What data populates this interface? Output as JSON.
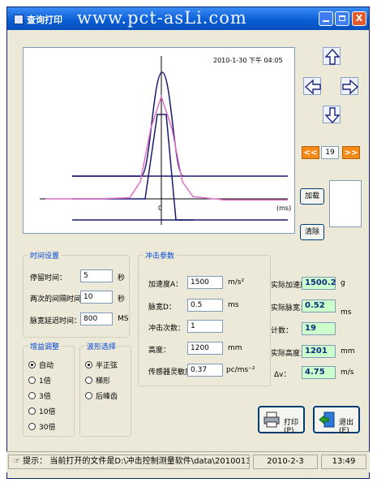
{
  "window": {
    "title": "查询打印",
    "watermark": "www.pct-asLi.com",
    "close_label": "X"
  },
  "chart": {
    "timestamp": "2010-1-30 下午 04:05",
    "x_zero_label": "0",
    "x_unit": "(ms)",
    "colors": {
      "envelope": "#1a1a6e",
      "signal": "#e06ec8",
      "axis": "#000000"
    }
  },
  "chart_data": {
    "type": "line",
    "title": "",
    "xlabel": "ms",
    "ylabel": "",
    "x": [
      -11,
      -6,
      -3,
      -2,
      -1,
      0,
      1,
      2,
      3,
      6,
      12
    ],
    "series": [
      {
        "values": [
          0,
          0,
          0.01,
          0.15,
          0.62,
          0.9,
          0.62,
          0.15,
          0.02,
          -0.01,
          -0.01
        ]
      }
    ]
  },
  "navigation": {
    "up_icon": "arrow-up-icon",
    "down_icon": "arrow-down-icon",
    "left_icon": "arrow-left-icon",
    "right_icon": "arrow-right-icon",
    "prev_label": "<<",
    "next_label": ">>",
    "page": "19"
  },
  "side_buttons": {
    "load": "加载",
    "clear": "清除"
  },
  "time_settings": {
    "title": "时间设置",
    "stop_time_label": "停留时间：",
    "stop_time_value": "5",
    "stop_time_unit": "秒",
    "interval_label": "两次的间隔时间：",
    "interval_value": "10",
    "interval_unit": "秒",
    "pulse_width_label": "脉宽延迟时间：",
    "pulse_width_value": "800",
    "pulse_width_unit": "MS"
  },
  "impact_params": {
    "title": "冲击参数",
    "accel_label": "加速度A：",
    "accel_value": "1500",
    "accel_unit": "m/s²",
    "pulse_label": "脉宽D：",
    "pulse_value": "0.5",
    "pulse_unit": "ms",
    "count_label": "冲击次数：",
    "count_value": "1",
    "height_label": "高度：",
    "height_value": "1200",
    "height_unit": "mm",
    "sensitivity_label": "传感器灵敏度：",
    "sensitivity_value": "0.37",
    "sensitivity_unit": "pc/ms⁻²"
  },
  "results": {
    "actual_accel_label": "实际加速度：",
    "actual_accel_value": "1500.2",
    "actual_accel_unit": "g",
    "actual_pulse_label": "实际脉宽：",
    "actual_pulse_value": "0.52",
    "actual_pulse_unit": "ms",
    "count_label": "计数：",
    "count_value": "19",
    "actual_height_label": "实际高度：",
    "actual_height_value": "1201",
    "actual_height_unit": "mm",
    "dv_label": "Δv：",
    "dv_value": "4.75",
    "dv_unit": "m/s"
  },
  "gain": {
    "title": "增益调整",
    "options": [
      "自动",
      "1倍",
      "3倍",
      "10倍",
      "30倍"
    ],
    "selected": "自动"
  },
  "waveform": {
    "title": "波形选择",
    "options": [
      "半正弦",
      "梯形",
      "后峰齿"
    ],
    "selected": "半正弦"
  },
  "buttons": {
    "print": "打印(P)",
    "exit": "退出(E)"
  },
  "status": {
    "icon": "hand-pointer-icon",
    "hint_label": "提示：",
    "message": "当前打开的文件是D:\\冲击控制测量软件\\data\\201001301607.",
    "date": "2010-2-3",
    "time": "13:49"
  }
}
